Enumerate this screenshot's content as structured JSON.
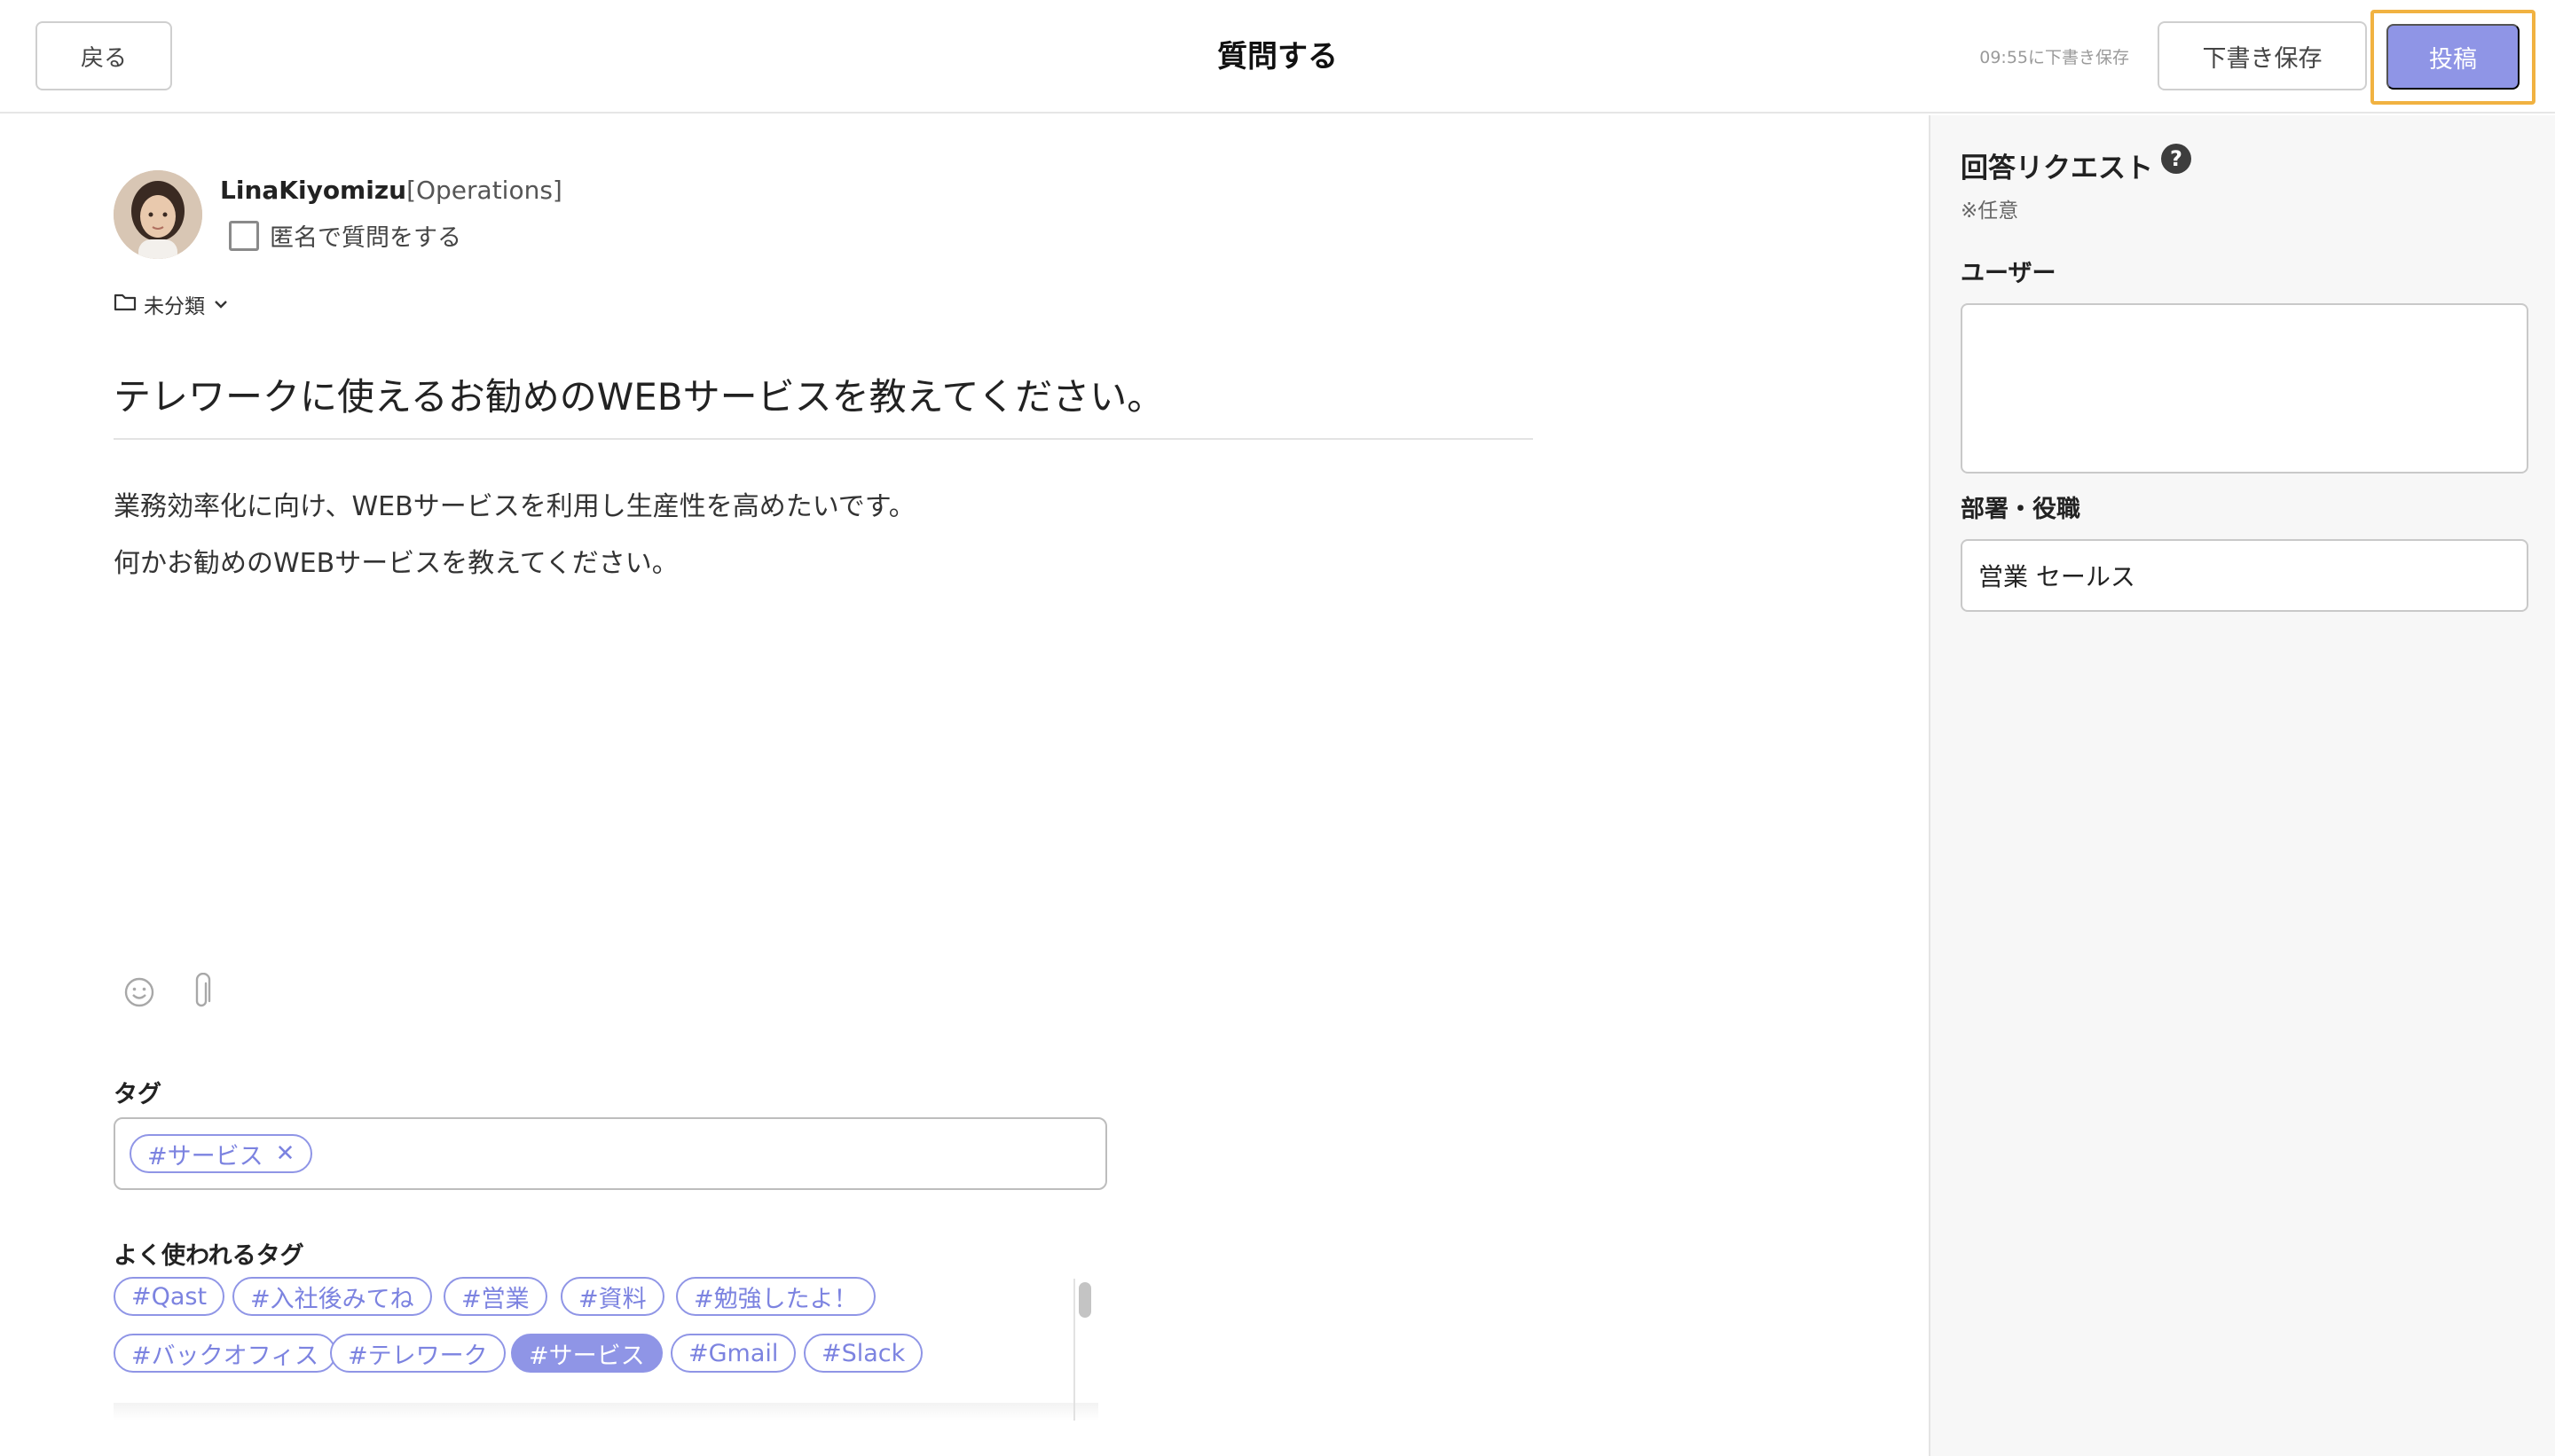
{
  "header": {
    "back_label": "戻る",
    "title": "質問する",
    "autosave_text": "09:55に下書き保存",
    "draft_label": "下書き保存",
    "post_label": "投稿"
  },
  "author": {
    "name": "LinaKiyomizu",
    "dept": "[Operations]",
    "anonymous_label": "匿名で質問をする",
    "anonymous_checked": false
  },
  "category": {
    "icon": "folder-icon",
    "label": "未分類"
  },
  "question": {
    "title": "テレワークに使えるお勧めのWEBサービスを教えてください。",
    "body": [
      "業務効率化に向け、WEBサービスを利用し生産性を高めたいです。",
      "何かお勧めのWEBサービスを教えてください。"
    ]
  },
  "toolbar": {
    "emoji_icon": "smiley-icon",
    "attach_icon": "paperclip-icon"
  },
  "tags": {
    "label": "タグ",
    "selected": [
      "#サービス"
    ],
    "popular_label": "よく使われるタグ",
    "popular": [
      "#Qast",
      "#入社後みてね",
      "#営業",
      "#資料",
      "#勉強したよ！",
      "#バックオフィス",
      "#テレワーク",
      "#サービス",
      "#Gmail",
      "#Slack"
    ],
    "popular_selected": "#サービス"
  },
  "sidebar": {
    "title": "回答リクエスト",
    "help_icon": "question-circle-icon",
    "note": "※任意",
    "users_label": "ユーザー",
    "dept_label": "部署・役職",
    "dept_value": "営業 セールス"
  },
  "colors": {
    "accent": "#8f95e6",
    "highlight": "#f1b241"
  }
}
